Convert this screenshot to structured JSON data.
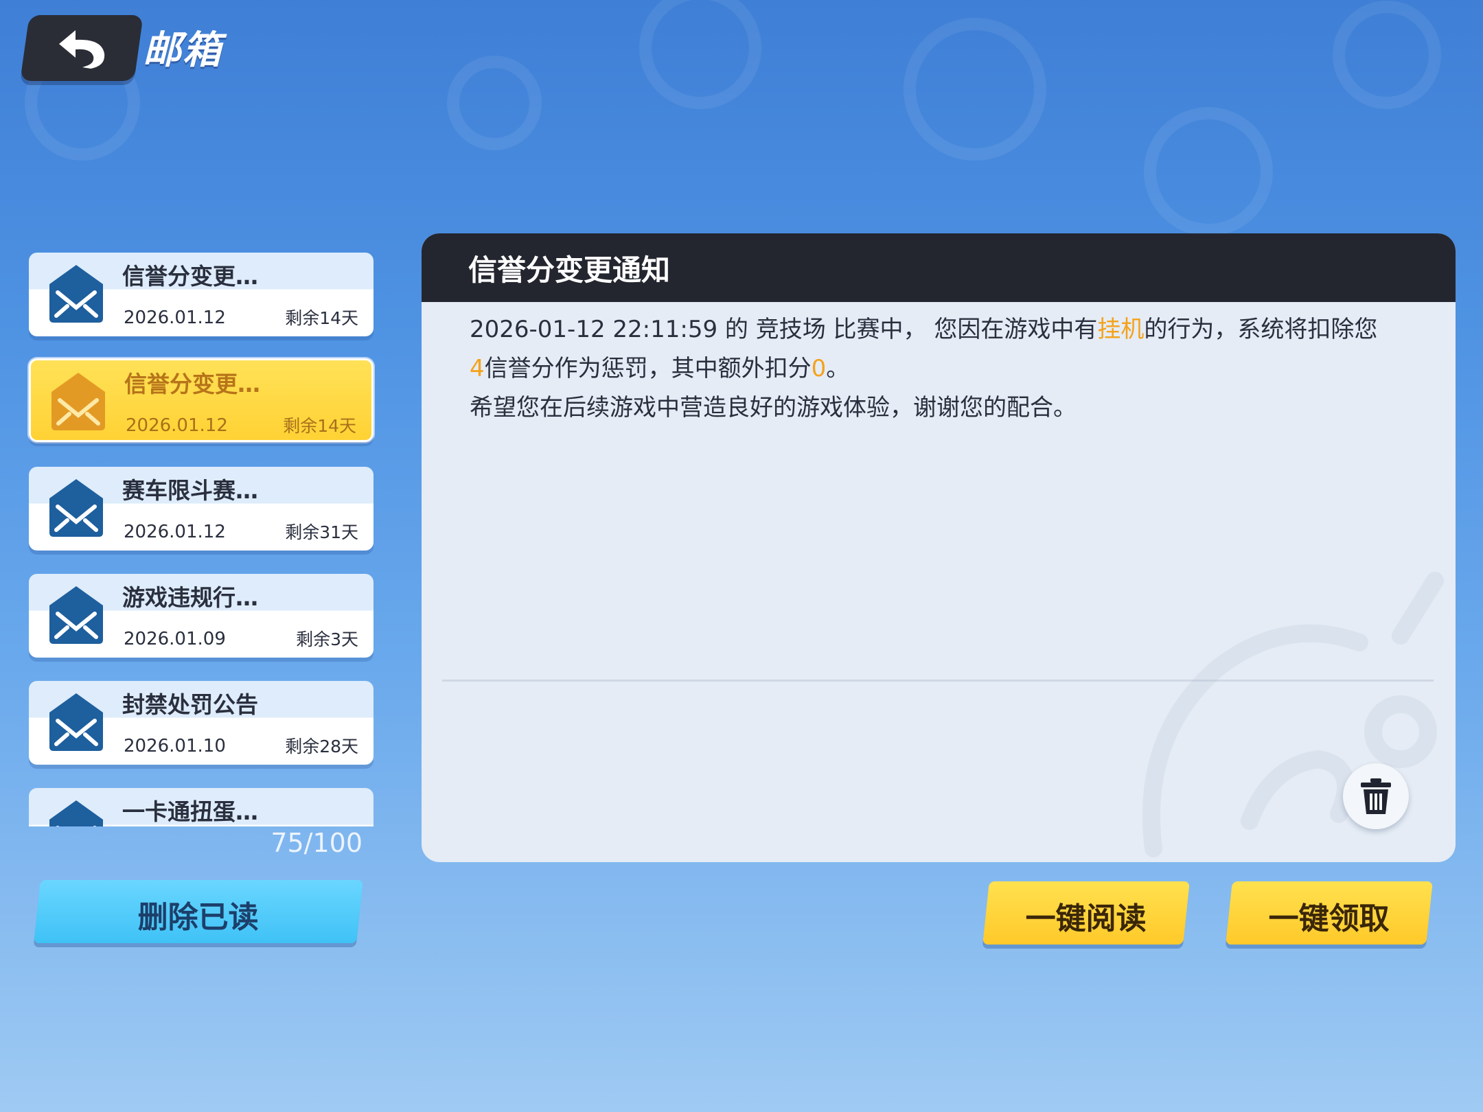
{
  "header": {
    "title": "邮箱"
  },
  "mail_list": {
    "items": [
      {
        "subject": "信誉分变更…",
        "date": "2026.01.12",
        "remaining": "剩余14天",
        "selected": false
      },
      {
        "subject": "信誉分变更…",
        "date": "2026.01.12",
        "remaining": "剩余14天",
        "selected": true
      },
      {
        "subject": "赛车限斗赛…",
        "date": "2026.01.12",
        "remaining": "剩余31天",
        "selected": false
      },
      {
        "subject": "游戏违规行…",
        "date": "2026.01.09",
        "remaining": "剩余3天",
        "selected": false
      },
      {
        "subject": "封禁处罚公告",
        "date": "2026.01.10",
        "remaining": "剩余28天",
        "selected": false
      },
      {
        "subject": "一卡通扭蛋…",
        "date": "",
        "remaining": "",
        "selected": false
      }
    ],
    "count": "75/100",
    "delete_read_label": "删除已读"
  },
  "detail": {
    "title": "信誉分变更通知",
    "line1_part1": "2026-01-12 22:11:59 的 竞技场 比赛中， 您因在游戏中有",
    "line1_highlight": "挂机",
    "line1_part2": "的行为，系统将扣除您",
    "line2_value": "4",
    "line2_part1": "信誉分作为惩罚，其中额外扣分",
    "line2_extra": "0",
    "line2_end": "。",
    "line3": "希望您在后续游戏中营造良好的游戏体验，谢谢您的配合。"
  },
  "actions": {
    "read_all_label": "一键阅读",
    "claim_all_label": "一键领取"
  },
  "colors": {
    "highlight": "#f4a21b",
    "selected_item": "#ffd234",
    "envelope_blue": "#1e5f9e"
  }
}
